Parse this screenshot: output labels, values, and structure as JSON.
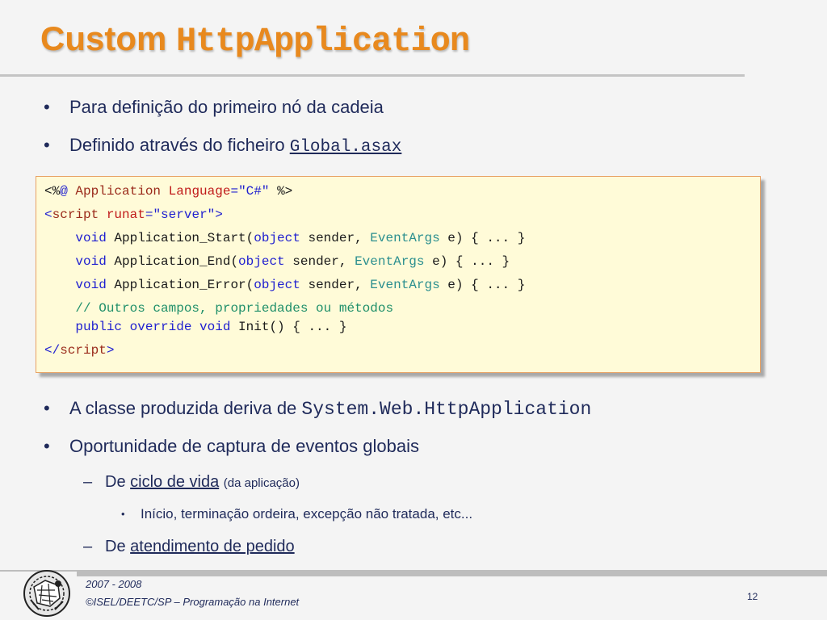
{
  "slide": {
    "title_prefix": "Custom",
    "title_mono": "HttpApplication"
  },
  "bullets": [
    {
      "bullet": "•",
      "text": "Para definição do primeiro nó da cadeia"
    },
    {
      "bullet": "•",
      "text_prefix": "Definido através do ficheiro",
      "link": "Global.asax"
    },
    {
      "bullet": "•",
      "text_prefix": "A classe produzida deriva de",
      "mono": "System.Web.HttpApplication"
    },
    {
      "bullet": "•",
      "text": "Oportunidade de captura de eventos globais"
    }
  ],
  "sub_items": [
    {
      "dash": "–",
      "prefix": "De",
      "link": "ciclo de vida",
      "suffix": "(da aplicação)"
    },
    {
      "dash": "–",
      "prefix": "De",
      "link": "atendimento de pedido"
    }
  ],
  "sub_sub_items": [
    {
      "bullet": "•",
      "text": "Início, terminação ordeira, excepção não tratada, etc..."
    }
  ],
  "code": {
    "l1": {
      "open": "<%",
      "at": "@",
      "directive": " Application ",
      "attr": "Language",
      "eq": "=",
      "val": "\"C#\"",
      "close": " %>"
    },
    "l2": {
      "open": "<",
      "tag": "script",
      "sp": " ",
      "attr": "runat",
      "eq": "=",
      "val": "\"server\"",
      "close": ">"
    },
    "l3": {
      "indent": "    ",
      "kw": "void",
      "name": " Application_Start(",
      "kw2": "object",
      "mid": " sender, ",
      "type": "EventArgs",
      "end": " e) { ... }"
    },
    "l4": {
      "indent": "    ",
      "kw": "void",
      "name": " Application_End(",
      "kw2": "object",
      "mid": " sender, ",
      "type": "EventArgs",
      "end": " e) { ... }"
    },
    "l5": {
      "indent": "    ",
      "kw": "void",
      "name": " Application_Error(",
      "kw2": "object",
      "mid": " sender, ",
      "type": "EventArgs",
      "end": " e) { ... }"
    },
    "l6": {
      "indent": "    ",
      "comment": "// Outros campos, propriedades ou métodos"
    },
    "l7": {
      "indent": "    ",
      "kw": "public override void",
      "end": " Init() { ... }"
    },
    "l8": {
      "open": "</",
      "tag": "script",
      "close": ">"
    }
  },
  "footer": {
    "years": "2007 - 2008",
    "copyright": "©ISEL/DEETC/SP – Programação na Internet",
    "page_number": "12"
  },
  "colors": {
    "title": "#e8891e",
    "text": "#1f2a5a",
    "code_bg": "#fffbd8",
    "code_border": "#e8a264"
  }
}
